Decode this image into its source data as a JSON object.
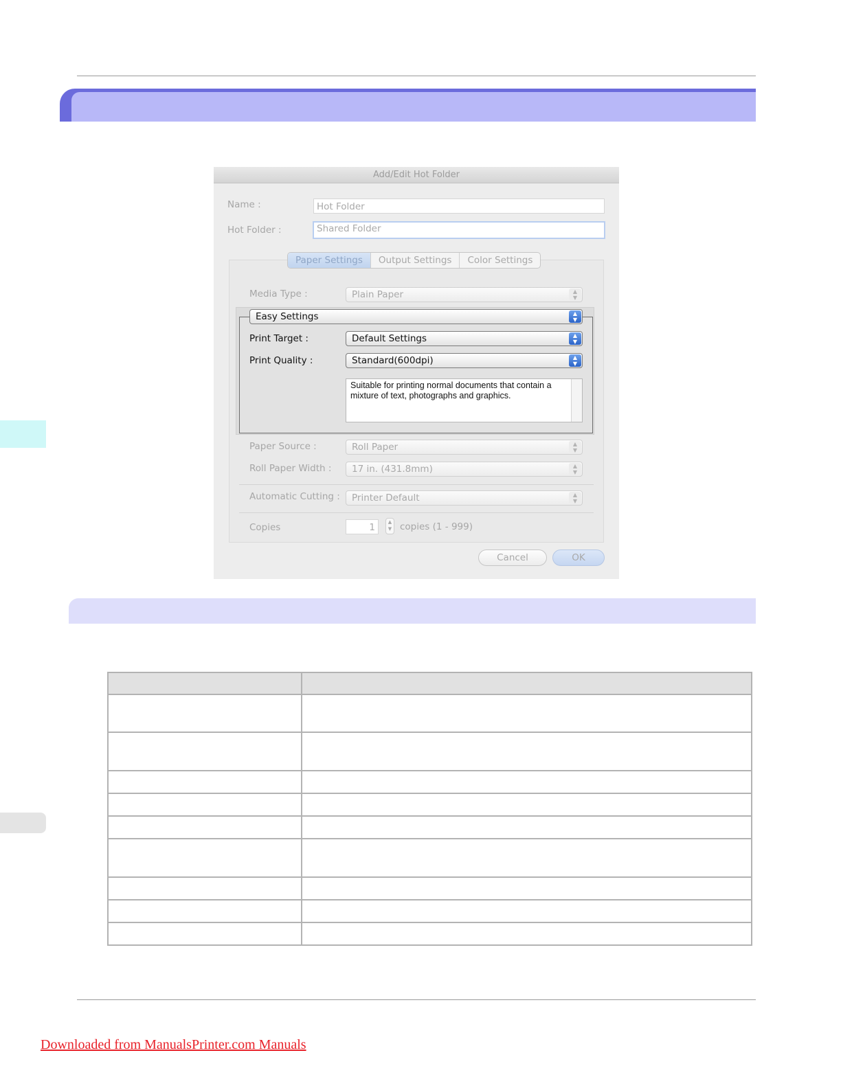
{
  "dialog": {
    "title": "Add/Edit Hot Folder",
    "name_label": "Name :",
    "name_value": "Hot Folder",
    "hot_folder_label": "Hot Folder :",
    "hot_folder_value": "Shared Folder",
    "tabs": [
      "Paper Settings",
      "Output Settings",
      "Color Settings"
    ],
    "selected_tab": "Paper Settings",
    "media_type_label": "Media Type :",
    "media_type_value": "Plain Paper",
    "easy_settings_value": "Easy Settings",
    "print_target_label": "Print Target :",
    "print_target_value": "Default Settings",
    "print_quality_label": "Print Quality :",
    "print_quality_value": "Standard(600dpi)",
    "description": "Suitable for printing normal documents that contain a mixture of text, photographs and graphics.",
    "paper_source_label": "Paper Source :",
    "paper_source_value": "Roll Paper",
    "roll_width_label": "Roll Paper Width :",
    "roll_width_value": "17 in. (431.8mm)",
    "auto_cut_label": "Automatic Cutting :",
    "auto_cut_value": "Printer Default",
    "copies_label": "Copies",
    "copies_value": "1",
    "copies_range": "copies (1 - 999)",
    "cancel_label": "Cancel",
    "ok_label": "OK"
  },
  "table": {
    "row_count": 9
  },
  "footer": {
    "link_text": "Downloaded from ManualsPrinter.com Manuals"
  },
  "colors": {
    "title_band": "#6b6bdc",
    "title_band_inner": "#b8b8f8",
    "section_band": "#dedefb",
    "footer_link": "#e8222a"
  }
}
